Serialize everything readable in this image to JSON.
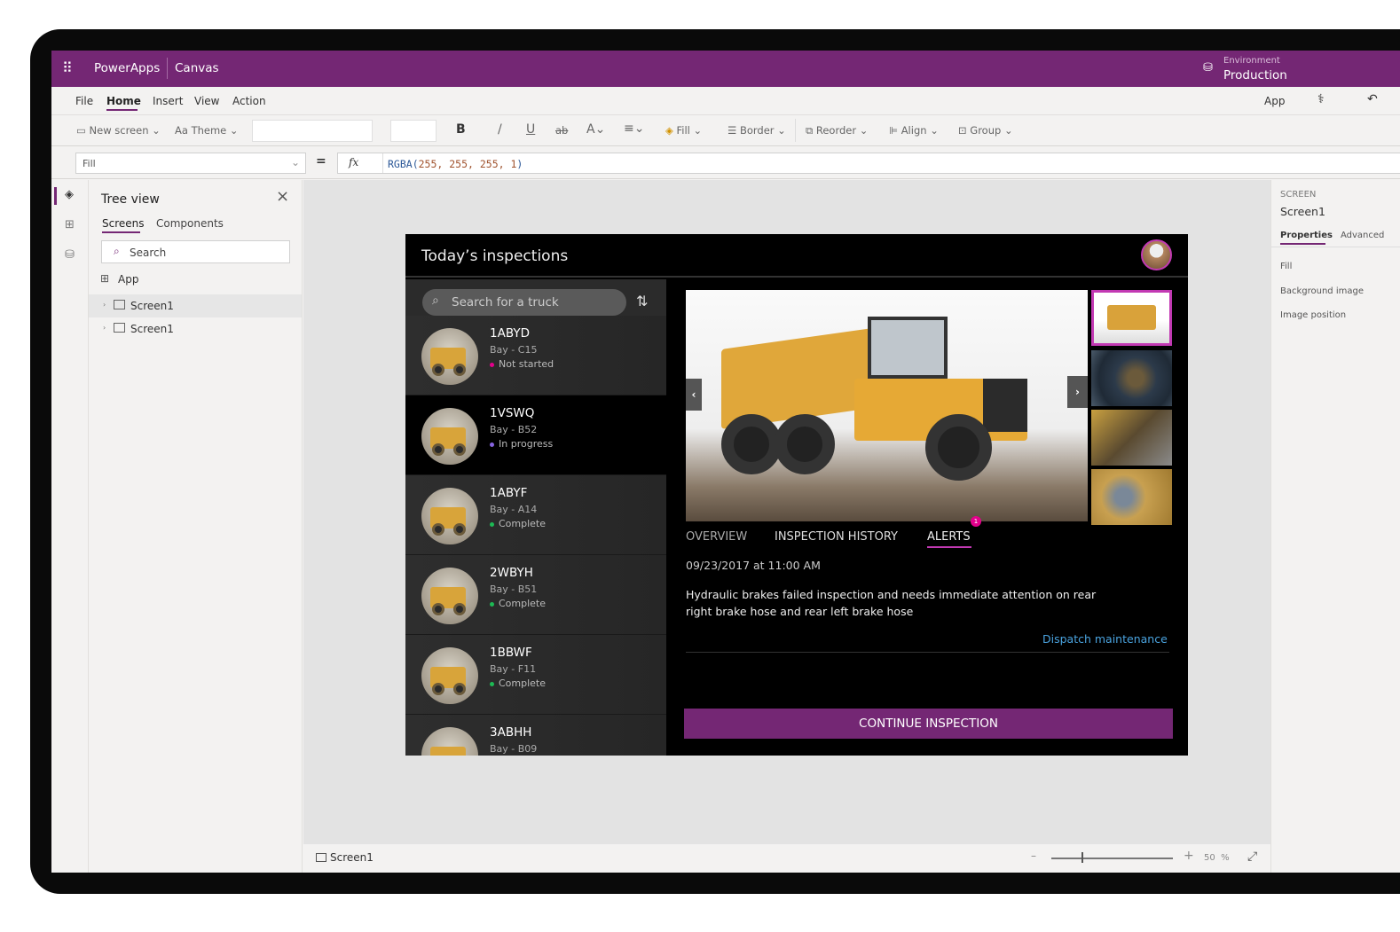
{
  "topbar": {
    "app_name": "PowerApps",
    "mode": "Canvas",
    "env_label": "Environment",
    "env_value": "Production"
  },
  "menu": {
    "items": [
      "File",
      "Home",
      "Insert",
      "View",
      "Action"
    ],
    "active": "Home",
    "right_app": "App"
  },
  "toolbar": {
    "new_screen": "New screen",
    "theme": "Theme",
    "bold": "B",
    "italic": "/",
    "underline": "U",
    "fill": "Fill",
    "border": "Border",
    "reorder": "Reorder",
    "align": "Align",
    "group": "Group"
  },
  "formula": {
    "property": "Fill",
    "equals": "=",
    "fx": "fx",
    "value_fn": "RGBA(",
    "value_args": "255, 255, 255, 1",
    "value_close": ")"
  },
  "tree": {
    "title": "Tree view",
    "tabs": [
      "Screens",
      "Components"
    ],
    "search_placeholder": "Search",
    "app": "App",
    "screens": [
      "Screen1",
      "Screen1"
    ]
  },
  "props": {
    "section": "SCREEN",
    "name": "Screen1",
    "tabs": [
      "Properties",
      "Advanced"
    ],
    "items": [
      "Fill",
      "Background image",
      "Image position"
    ]
  },
  "status": {
    "screen": "Screen1",
    "zoom": "50",
    "zoom_unit": "%",
    "zoom_level": 0.5
  },
  "app": {
    "title": "Today’s inspections",
    "search_placeholder": "Search for a truck",
    "trucks": [
      {
        "id": "1ABYD",
        "bay": "Bay - C15",
        "status": "Not started",
        "color": "#e3008c"
      },
      {
        "id": "1VSWQ",
        "bay": "Bay - B52",
        "status": "In progress",
        "color": "#8764e0"
      },
      {
        "id": "1ABYF",
        "bay": "Bay - A14",
        "status": "Complete",
        "color": "#1db954"
      },
      {
        "id": "2WBYH",
        "bay": "Bay - B51",
        "status": "Complete",
        "color": "#1db954"
      },
      {
        "id": "1BBWF",
        "bay": "Bay - F11",
        "status": "Complete",
        "color": "#1db954"
      },
      {
        "id": "3ABHH",
        "bay": "Bay - B09",
        "status": "",
        "color": "#1db954"
      }
    ],
    "tabs": [
      "OVERVIEW",
      "INSPECTION HISTORY",
      "ALERTS"
    ],
    "alert_count": "1",
    "date": "09/23/2017 at 11:00 AM",
    "alert_text": "Hydraulic brakes failed inspection and needs immediate attention on rear right brake hose and rear left brake hose",
    "dispatch": "Dispatch maintenance",
    "continue": "CONTINUE INSPECTION"
  },
  "colors": {
    "brand": "#742774",
    "accent_pink": "#c239b3",
    "link": "#4aa3df"
  }
}
